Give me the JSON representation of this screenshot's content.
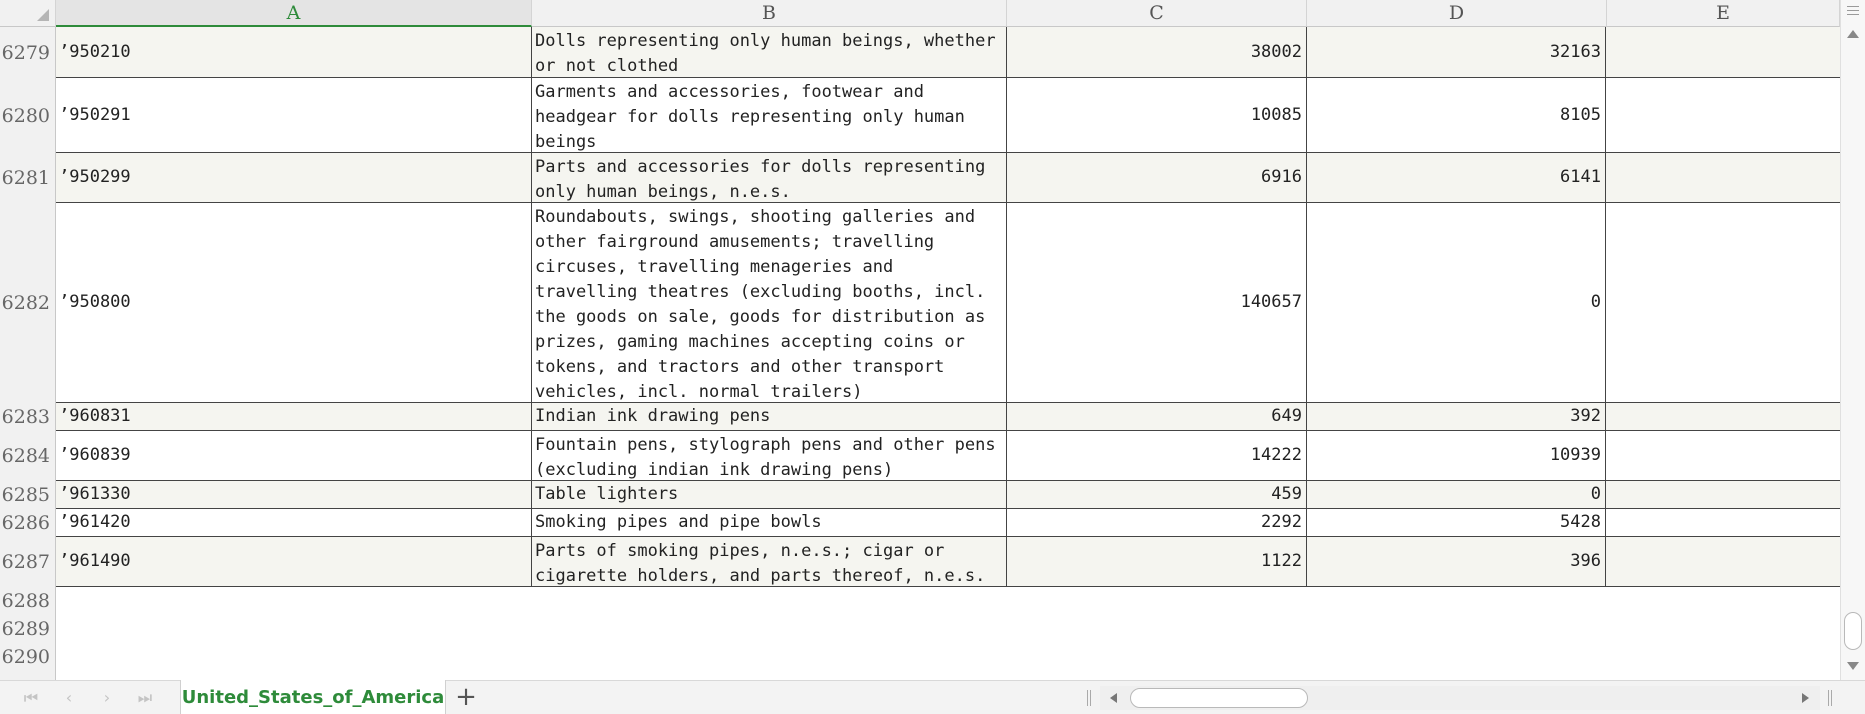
{
  "columns": [
    "A",
    "B",
    "C",
    "D",
    "E"
  ],
  "active_column": "A",
  "rows": [
    {
      "num": "6279",
      "a": "’950210",
      "b": "Dolls representing only human beings, whether or not clothed",
      "c": "38002",
      "d": "32163"
    },
    {
      "num": "6280",
      "a": "’950291",
      "b": "Garments and accessories, footwear and headgear for dolls representing only human beings",
      "c": "10085",
      "d": "8105"
    },
    {
      "num": "6281",
      "a": "’950299",
      "b": "Parts and accessories for dolls representing only human beings, n.e.s.",
      "c": "6916",
      "d": "6141"
    },
    {
      "num": "6282",
      "a": "’950800",
      "b": "Roundabouts, swings, shooting galleries and other fairground amusements; travelling circuses, travelling menageries and travelling theatres (excluding booths, incl. the goods on sale, goods for distribution as prizes, gaming machines accepting coins or tokens, and tractors and other transport vehicles, incl. normal trailers)",
      "c": "140657",
      "d": "0"
    },
    {
      "num": "6283",
      "a": "’960831",
      "b": "Indian ink drawing pens",
      "c": "649",
      "d": "392"
    },
    {
      "num": "6284",
      "a": "’960839",
      "b": "Fountain pens, stylograph pens and other pens (excluding indian ink drawing pens)",
      "c": "14222",
      "d": "10939"
    },
    {
      "num": "6285",
      "a": "’961330",
      "b": "Table lighters",
      "c": "459",
      "d": "0"
    },
    {
      "num": "6286",
      "a": "’961420",
      "b": "Smoking pipes and pipe bowls",
      "c": "2292",
      "d": "5428"
    },
    {
      "num": "6287",
      "a": "’961490",
      "b": "Parts of smoking pipes, n.e.s.; cigar or cigarette holders, and parts thereof, n.e.s.",
      "c": "1122",
      "d": "396"
    }
  ],
  "empty_rows": [
    "6288",
    "6289",
    "6290"
  ],
  "sheet_tab": "United_States_of_America",
  "add_sheet_symbol": "+",
  "colors": {
    "accent": "#2e8b3a",
    "grid": "#444444",
    "row_band": "#f5f5f0"
  }
}
